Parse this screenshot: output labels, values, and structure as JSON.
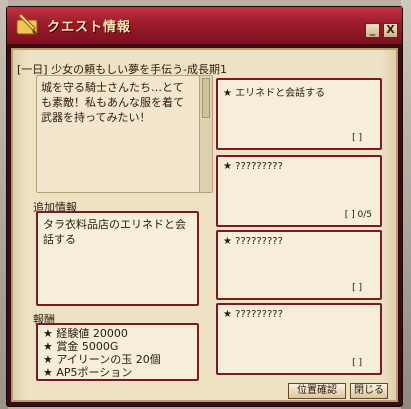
{
  "window": {
    "title": "クエスト情報",
    "minimize_glyph": "_",
    "close_glyph": "X"
  },
  "quest": {
    "title": "[一日] 少女の頼もしい夢を手伝う-成長期1",
    "description": "城を守る騎士さんたち…とても素敵！私もあんな服を着て武器を持ってみたい！"
  },
  "additional_info": {
    "label": "追加情報",
    "text": "タラ衣料品店のエリネドと会話する"
  },
  "rewards": {
    "label": "報酬",
    "items": [
      "★ 経験値 20000",
      "★ 賞金 5000G",
      "★ アイリーンの玉 20個",
      "★ AP5ポーション"
    ]
  },
  "objectives": [
    {
      "text": "★ エリネドと会話する",
      "count": "[ ]"
    },
    {
      "text": "★ ?????????",
      "count": "[ ] 0/5"
    },
    {
      "text": "★ ?????????",
      "count": "[ ]"
    },
    {
      "text": "★ ?????????",
      "count": "[ ]"
    }
  ],
  "buttons": {
    "position_check": "位置確認",
    "close": "閉じる"
  },
  "icons": {
    "title": "scroll-feather-icon"
  },
  "colors": {
    "titlebar": "#9c1b2a",
    "frame_border": "#7a1a24",
    "parchment": "#eee2c4"
  }
}
